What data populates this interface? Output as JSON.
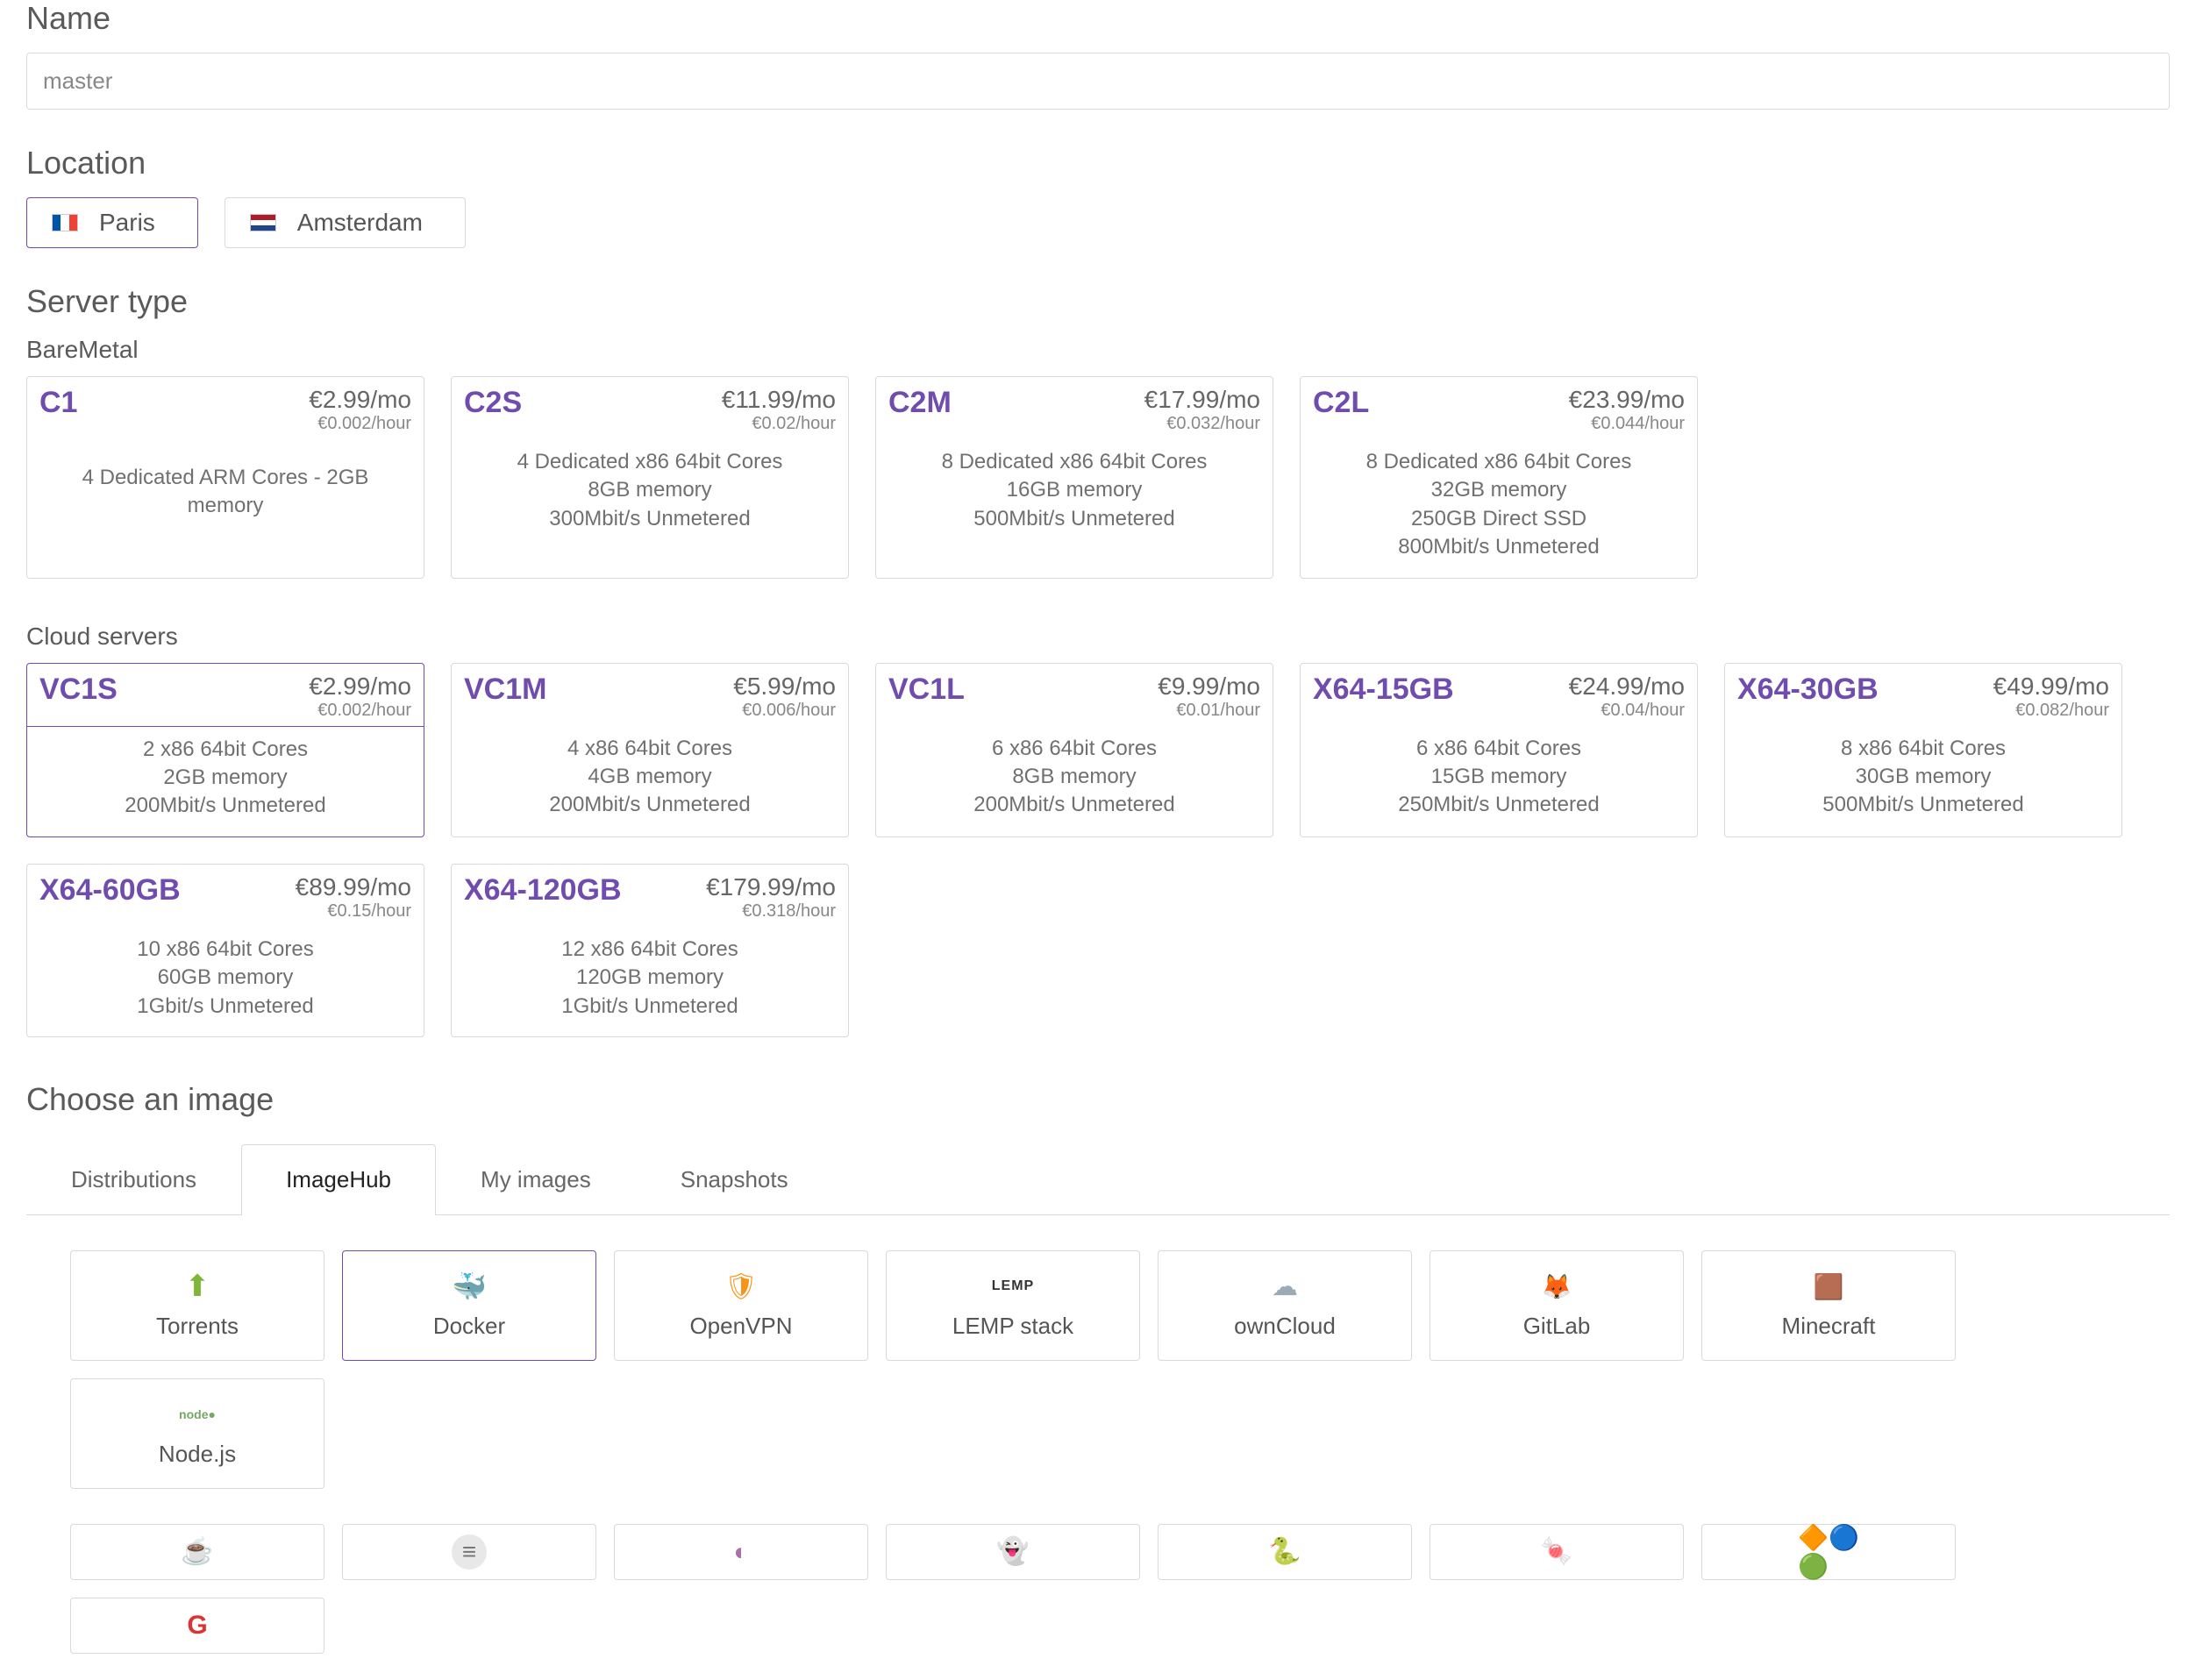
{
  "headings": {
    "name": "Name",
    "location": "Location",
    "server_type": "Server type",
    "choose_image": "Choose an image"
  },
  "name_input": {
    "value": "master"
  },
  "locations": [
    {
      "label": "Paris",
      "flag": "fr",
      "selected": true
    },
    {
      "label": "Amsterdam",
      "flag": "nl",
      "selected": false
    }
  ],
  "server_groups": [
    {
      "heading": "BareMetal",
      "servers": [
        {
          "name": "C1",
          "price_mo": "€2.99/mo",
          "price_hr": "€0.002/hour",
          "specs": [
            "4 Dedicated ARM Cores - 2GB memory"
          ],
          "selected": false
        },
        {
          "name": "C2S",
          "price_mo": "€11.99/mo",
          "price_hr": "€0.02/hour",
          "specs": [
            "4 Dedicated x86 64bit Cores",
            "8GB memory",
            "300Mbit/s Unmetered"
          ],
          "selected": false
        },
        {
          "name": "C2M",
          "price_mo": "€17.99/mo",
          "price_hr": "€0.032/hour",
          "specs": [
            "8 Dedicated x86 64bit Cores",
            "16GB memory",
            "500Mbit/s Unmetered"
          ],
          "selected": false
        },
        {
          "name": "C2L",
          "price_mo": "€23.99/mo",
          "price_hr": "€0.044/hour",
          "specs": [
            "8 Dedicated x86 64bit Cores",
            "32GB memory",
            "250GB Direct SSD",
            "800Mbit/s Unmetered"
          ],
          "selected": false
        }
      ]
    },
    {
      "heading": "Cloud servers",
      "servers": [
        {
          "name": "VC1S",
          "price_mo": "€2.99/mo",
          "price_hr": "€0.002/hour",
          "specs": [
            "2 x86 64bit Cores",
            "2GB memory",
            "200Mbit/s Unmetered"
          ],
          "selected": true
        },
        {
          "name": "VC1M",
          "price_mo": "€5.99/mo",
          "price_hr": "€0.006/hour",
          "specs": [
            "4 x86 64bit Cores",
            "4GB memory",
            "200Mbit/s Unmetered"
          ],
          "selected": false
        },
        {
          "name": "VC1L",
          "price_mo": "€9.99/mo",
          "price_hr": "€0.01/hour",
          "specs": [
            "6 x86 64bit Cores",
            "8GB memory",
            "200Mbit/s Unmetered"
          ],
          "selected": false
        },
        {
          "name": "X64-15GB",
          "price_mo": "€24.99/mo",
          "price_hr": "€0.04/hour",
          "specs": [
            "6 x86 64bit Cores",
            "15GB memory",
            "250Mbit/s Unmetered"
          ],
          "selected": false
        },
        {
          "name": "X64-30GB",
          "price_mo": "€49.99/mo",
          "price_hr": "€0.082/hour",
          "specs": [
            "8 x86 64bit Cores",
            "30GB memory",
            "500Mbit/s Unmetered"
          ],
          "selected": false
        },
        {
          "name": "X64-60GB",
          "price_mo": "€89.99/mo",
          "price_hr": "€0.15/hour",
          "specs": [
            "10 x86 64bit Cores",
            "60GB memory",
            "1Gbit/s Unmetered"
          ],
          "selected": false
        },
        {
          "name": "X64-120GB",
          "price_mo": "€179.99/mo",
          "price_hr": "€0.318/hour",
          "specs": [
            "12 x86 64bit Cores",
            "120GB memory",
            "1Gbit/s Unmetered"
          ],
          "selected": false
        }
      ]
    }
  ],
  "tabs": [
    {
      "label": "Distributions",
      "active": false
    },
    {
      "label": "ImageHub",
      "active": true
    },
    {
      "label": "My images",
      "active": false
    },
    {
      "label": "Snapshots",
      "active": false
    }
  ],
  "images_row1": [
    {
      "label": "Torrents",
      "icon": "torrent",
      "selected": false
    },
    {
      "label": "Docker",
      "icon": "docker",
      "selected": true
    },
    {
      "label": "OpenVPN",
      "icon": "openvpn",
      "selected": false
    },
    {
      "label": "LEMP stack",
      "icon": "lemp",
      "selected": false
    },
    {
      "label": "ownCloud",
      "icon": "owncloud",
      "selected": false
    },
    {
      "label": "GitLab",
      "icon": "gitlab",
      "selected": false
    },
    {
      "label": "Minecraft",
      "icon": "minecraft",
      "selected": false
    },
    {
      "label": "Node.js",
      "icon": "nodejs",
      "selected": false
    }
  ],
  "images_row2": [
    {
      "label": "",
      "icon": "java",
      "selected": false
    },
    {
      "label": "",
      "icon": "generic",
      "selected": false
    },
    {
      "label": "",
      "icon": "presta",
      "selected": false
    },
    {
      "label": "",
      "icon": "ghost",
      "selected": false
    },
    {
      "label": "",
      "icon": "py",
      "selected": false
    },
    {
      "label": "",
      "icon": "cane",
      "selected": false
    },
    {
      "label": "",
      "icon": "cluster",
      "selected": false
    },
    {
      "label": "",
      "icon": "red",
      "selected": false
    }
  ]
}
